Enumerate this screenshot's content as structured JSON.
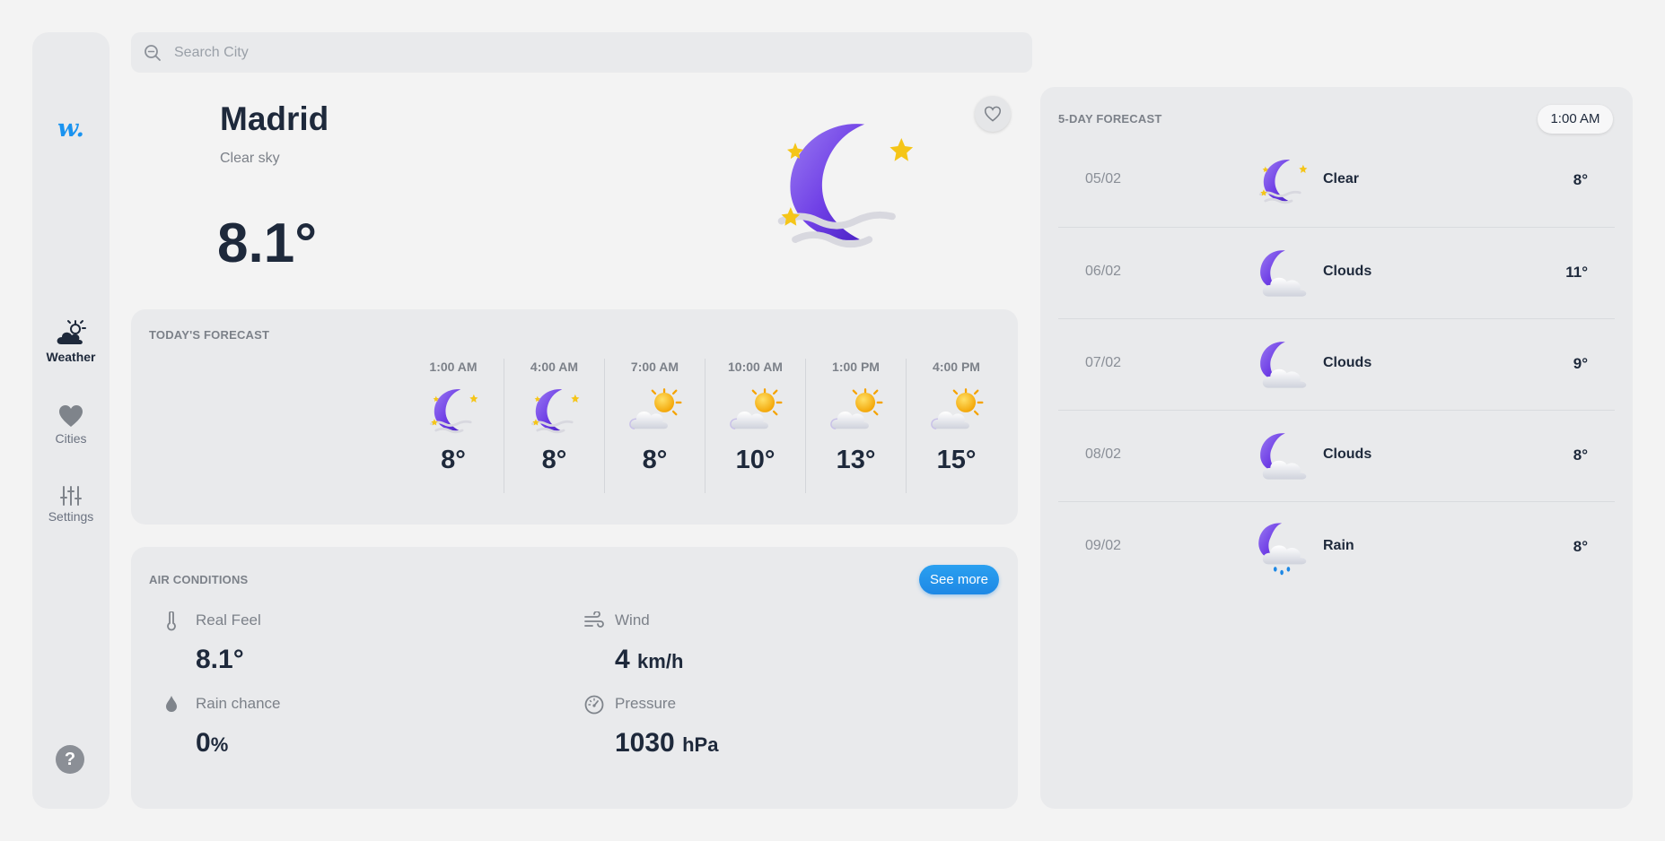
{
  "sidebar": {
    "logo": "w.",
    "items": [
      {
        "label": "Weather",
        "icon": "cloud-sun-icon",
        "active": true
      },
      {
        "label": "Cities",
        "icon": "heart-icon",
        "active": false
      },
      {
        "label": "Settings",
        "icon": "sliders-icon",
        "active": false
      }
    ],
    "help_label": "?"
  },
  "search": {
    "placeholder": "Search City",
    "value": ""
  },
  "current": {
    "city": "Madrid",
    "condition": "Clear sky",
    "temperature": "8.1°",
    "icon": "moon-stars-icon"
  },
  "today_forecast": {
    "title": "TODAY'S FORECAST",
    "hours": [
      {
        "time": "1:00 AM",
        "icon": "moon-stars-icon",
        "temp": "8°"
      },
      {
        "time": "4:00 AM",
        "icon": "moon-stars-icon",
        "temp": "8°"
      },
      {
        "time": "7:00 AM",
        "icon": "sun-cloud-icon",
        "temp": "8°"
      },
      {
        "time": "10:00 AM",
        "icon": "sun-cloud-icon",
        "temp": "10°"
      },
      {
        "time": "1:00 PM",
        "icon": "sun-cloud-icon",
        "temp": "13°"
      },
      {
        "time": "4:00 PM",
        "icon": "sun-cloud-icon",
        "temp": "15°"
      }
    ]
  },
  "air_conditions": {
    "title": "AIR CONDITIONS",
    "see_more": "See more",
    "metrics": [
      {
        "label": "Real Feel",
        "value": "8.1°",
        "unit": "",
        "icon": "thermometer-icon"
      },
      {
        "label": "Wind",
        "value": "4",
        "unit": "km/h",
        "icon": "wind-icon"
      },
      {
        "label": "Rain chance",
        "value": "0",
        "unit": "%",
        "icon": "droplet-icon"
      },
      {
        "label": "Pressure",
        "value": "1030",
        "unit": "hPa",
        "icon": "gauge-icon"
      }
    ]
  },
  "five_day": {
    "title": "5-DAY FORECAST",
    "time_badge": "1:00 AM",
    "days": [
      {
        "date": "05/02",
        "condition": "Clear",
        "temp": "8°",
        "icon": "moon-stars-icon"
      },
      {
        "date": "06/02",
        "condition": "Clouds",
        "temp": "11°",
        "icon": "moon-cloud-icon"
      },
      {
        "date": "07/02",
        "condition": "Clouds",
        "temp": "9°",
        "icon": "moon-cloud-icon"
      },
      {
        "date": "08/02",
        "condition": "Clouds",
        "temp": "8°",
        "icon": "moon-cloud-icon"
      },
      {
        "date": "09/02",
        "condition": "Rain",
        "temp": "8°",
        "icon": "moon-rain-icon"
      }
    ]
  },
  "colors": {
    "background": "#f3f3f3",
    "panel": "#e9eaec",
    "accent": "#1e88e5",
    "moon": "#7b4fe0",
    "sun": "#f5b90f",
    "text": "#1e293b",
    "muted": "#7c8189"
  }
}
